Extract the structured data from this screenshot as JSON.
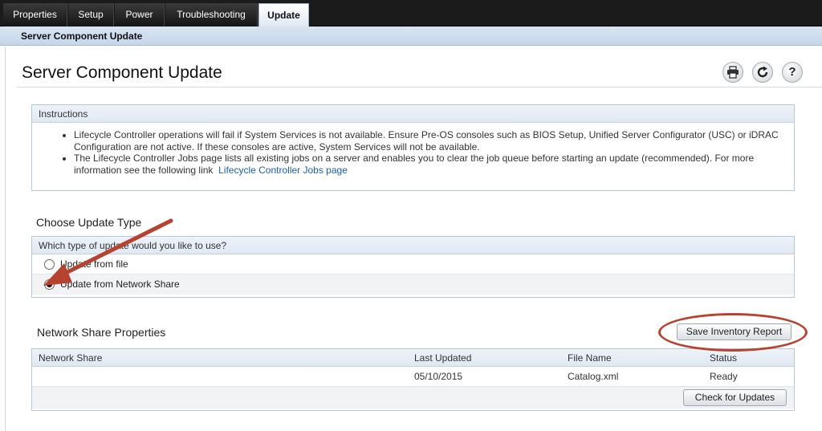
{
  "tabs": [
    {
      "label": "Properties"
    },
    {
      "label": "Setup"
    },
    {
      "label": "Power"
    },
    {
      "label": "Troubleshooting"
    },
    {
      "label": "Update"
    }
  ],
  "breadcrumb": "Server Component Update",
  "page_title": "Server Component Update",
  "toolbar": {
    "print_icon": "print-icon",
    "refresh_icon": "refresh-icon",
    "help_label": "?"
  },
  "instructions": {
    "header": "Instructions",
    "item1": "Lifecycle Controller operations will fail if System Services is not available. Ensure Pre-OS consoles such as BIOS Setup, Unified Server Configurator (USC) or iDRAC Configuration are not active. If these consoles are active, System Services will not be available.",
    "item2_text": "The Lifecycle Controller Jobs page lists all existing jobs on a server and enables you to clear the job queue before starting an update (recommended). For more information see the following link",
    "item2_link": "Lifecycle Controller Jobs page"
  },
  "update_type": {
    "title": "Choose Update Type",
    "question": "Which type of update would you like to use?",
    "options": [
      {
        "label": "Update from file",
        "selected": false
      },
      {
        "label": "Update from Network Share",
        "selected": true
      }
    ]
  },
  "network_share": {
    "title": "Network Share Properties",
    "save_button": "Save Inventory Report",
    "columns": [
      "Network Share",
      "Last Updated",
      "File Name",
      "Status"
    ],
    "rows": [
      {
        "share": "",
        "last_updated": "05/10/2015",
        "file_name": "Catalog.xml",
        "status": "Ready"
      }
    ],
    "check_button": "Check for Updates"
  },
  "annotation_color": "#b5432f"
}
